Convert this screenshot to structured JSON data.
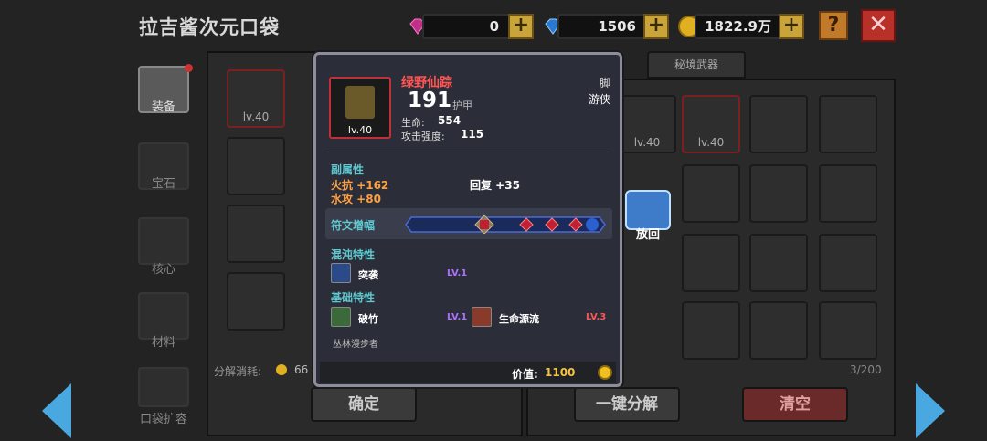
{
  "header": {
    "title": "拉吉酱次元口袋",
    "pink_gems": "0",
    "blue_gems": "1506",
    "gold": "1822.9万",
    "help_label": "?",
    "close_label": "✕"
  },
  "sidebar": [
    {
      "label": "装备",
      "active": true
    },
    {
      "label": "宝石"
    },
    {
      "label": "核心"
    },
    {
      "label": "材料"
    },
    {
      "label": "口袋扩容"
    }
  ],
  "tabs": {
    "secret_weapon": "秘境武器"
  },
  "inventory": {
    "slot1_level": "lv.40",
    "slot2_level": "lv.40",
    "slot3_level": "lv.40",
    "dismantle_label": "分解消耗:",
    "dismantle_cost": "66",
    "capacity": "3/200"
  },
  "buttons": {
    "confirm": "确定",
    "one_click": "一键分解",
    "clear": "清空",
    "put_back": "放回"
  },
  "item": {
    "name": "绿野仙踪",
    "level": "lv.40",
    "armor_value": "191",
    "armor_label": "护甲",
    "slot": "脚",
    "class": "游侠",
    "hp_label": "生命:",
    "hp_value": "554",
    "atk_label": "攻击强度:",
    "atk_value": "115",
    "sub_attr_title": "副属性",
    "fire_res": "火抗 +162",
    "regen": "回复 +35",
    "water_atk": "水攻 +80",
    "rune_label": "符文增幅",
    "chaos_title": "混沌特性",
    "chaos_skill": "突袭",
    "chaos_level": "LV.1",
    "base_title": "基础特性",
    "base_skill1": "破竹",
    "base_skill1_level": "LV.1",
    "base_skill2": "生命源流",
    "base_skill2_level": "LV.3",
    "set_name": "丛林漫步者",
    "price_label": "价值:",
    "price_value": "1100"
  },
  "colors": {
    "accent_gold": "#f5c242",
    "rarity_red": "#ff5555",
    "teal": "#5fc8d0",
    "orange": "#ffa040"
  }
}
